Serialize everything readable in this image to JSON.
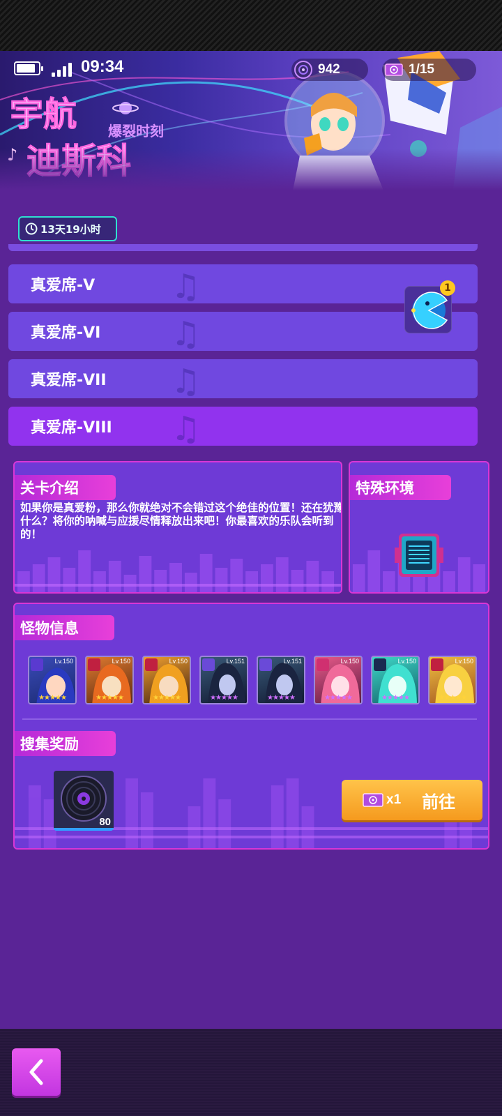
{
  "status_bar": {
    "time": "09:34"
  },
  "currency": {
    "discs": "942",
    "tickets": "1/15"
  },
  "event": {
    "timer": "13天19小时"
  },
  "seats": [
    {
      "label": "真爱席-V",
      "selected": false
    },
    {
      "label": "真爱席-VI",
      "selected": false
    },
    {
      "label": "真爱席-VII",
      "selected": false
    },
    {
      "label": "真爱席-VIII",
      "selected": true
    }
  ],
  "notification": {
    "count": "1"
  },
  "stage_intro": {
    "title": "关卡介绍",
    "text": "如果你是真爱粉，那么你就绝对不会错过这个绝佳的位置！还在犹豫什么？将你的呐喊与应援尽情释放出来吧！你最喜欢的乐队会听到的！"
  },
  "special_env": {
    "title": "特殊环境"
  },
  "monsters": {
    "title": "怪物信息",
    "list": [
      {
        "level": "Lv.150",
        "class": "tank",
        "star_color": "#ffd23a"
      },
      {
        "level": "Lv.150",
        "class": "tank",
        "star_color": "#ffd23a"
      },
      {
        "level": "Lv.150",
        "class": "tank",
        "star_color": "#ffd23a"
      },
      {
        "level": "Lv.151",
        "class": "warrior",
        "star_color": "#d070ff"
      },
      {
        "level": "Lv.151",
        "class": "warrior",
        "star_color": "#d070ff"
      },
      {
        "level": "Lv.150",
        "class": "support",
        "star_color": "#d070ff"
      },
      {
        "level": "Lv.150",
        "class": "support",
        "star_color": "#d070ff"
      },
      {
        "level": "Lv.150",
        "class": "support",
        "star_color": "#ffd23a"
      }
    ]
  },
  "rewards": {
    "title": "搜集奖励",
    "item_count": "80",
    "cost": "x1",
    "go_label": "前往"
  },
  "colors": {
    "accent_pink": "#e83fd9",
    "seat_bg": "#7048e0",
    "seat_active": "#9133ee",
    "button_orange": "#f59a1e",
    "timer_border": "#2fe0d0"
  }
}
